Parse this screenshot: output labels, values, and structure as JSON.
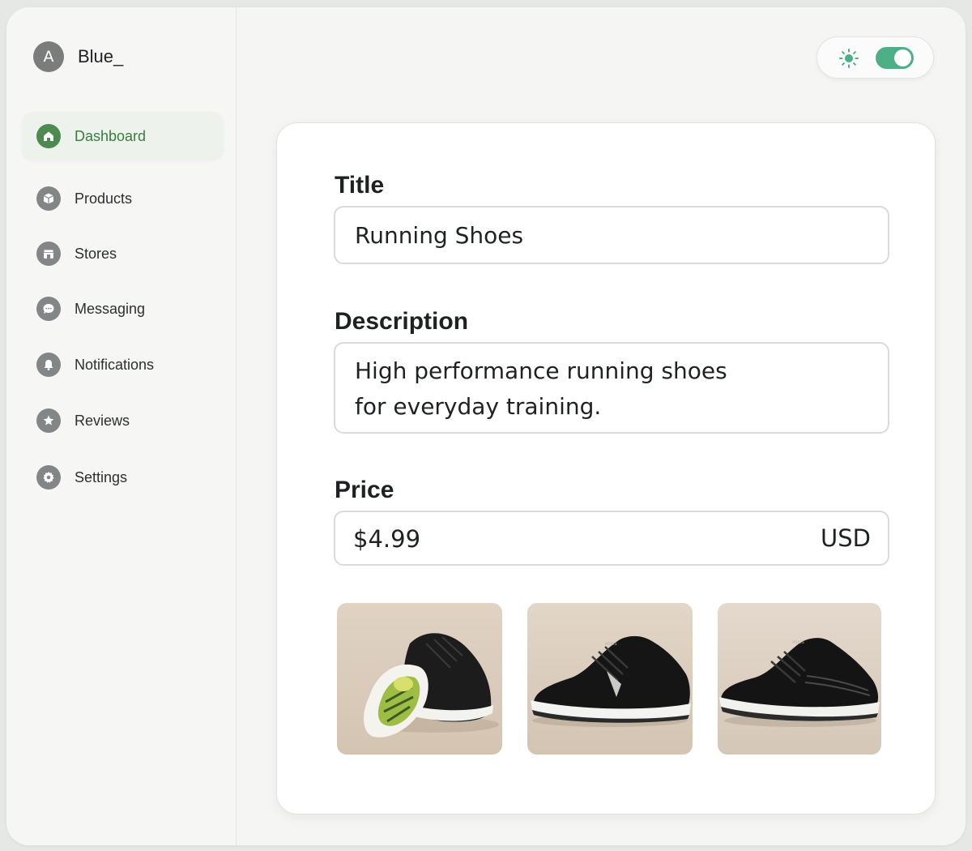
{
  "profile": {
    "avatar_letter": "A",
    "name": "Blue_"
  },
  "nav": [
    {
      "label": "Dashboard",
      "icon": "home-icon",
      "active": true
    },
    {
      "label": "Products",
      "icon": "box-icon",
      "active": false
    },
    {
      "label": "Stores",
      "icon": "store-icon",
      "active": false
    },
    {
      "label": "Messaging",
      "icon": "chat-icon",
      "active": false
    },
    {
      "label": "Notifications",
      "icon": "bell-icon",
      "active": false
    },
    {
      "label": "Reviews",
      "icon": "star-icon",
      "active": false
    },
    {
      "label": "Settings",
      "icon": "gear-icon",
      "active": false
    }
  ],
  "theme": {
    "icon": "sun-icon",
    "dark_mode_toggle_on": true,
    "accent": "#4caf85"
  },
  "form": {
    "title_label": "Title",
    "title_value": "Running Shoes",
    "description_label": "Description",
    "description_line1": "High performance running shoes",
    "description_line2": "for everyday training.",
    "price_label": "Price",
    "price_value": "$4.99",
    "currency": "USD"
  },
  "images": [
    {
      "name": "shoe-image-sole"
    },
    {
      "name": "shoe-image-side"
    },
    {
      "name": "shoe-image-angle"
    }
  ],
  "colors": {
    "active_nav": "#4d8a4f",
    "icon_gray": "#838686"
  }
}
